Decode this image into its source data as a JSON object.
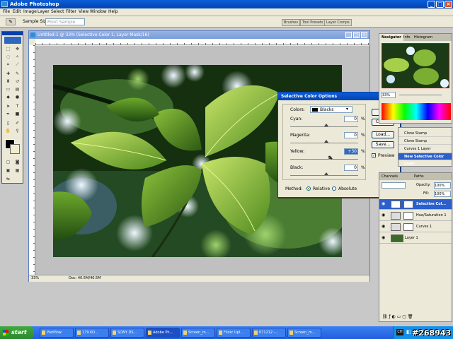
{
  "window": {
    "title": "Adobe Photoshop"
  },
  "menu": [
    "File",
    "Edit",
    "Image",
    "Layer",
    "Select",
    "Filter",
    "View",
    "Window",
    "Help"
  ],
  "options_bar": {
    "sample_size_label": "Sample Size:",
    "sample_size_value": "Point Sample"
  },
  "palette_well": [
    "Brushes",
    "Tool Presets",
    "Layer Comps"
  ],
  "document": {
    "title": "Untitled-1 @ 33% (Selective Color 1, Layer Mask/16)",
    "zoom": "33%",
    "doc_size": "Doc: 40.5M/40.5M"
  },
  "dialog": {
    "title": "Selective Color Options",
    "colors_label": "Colors:",
    "colors_value": "Blacks",
    "fields": [
      {
        "label": "Cyan:",
        "value": "0",
        "pct": "%"
      },
      {
        "label": "Magenta:",
        "value": "0",
        "pct": "%"
      },
      {
        "label": "Yellow:",
        "value": "+30",
        "pct": "%"
      },
      {
        "label": "Black:",
        "value": "0",
        "pct": "%"
      }
    ],
    "method_label": "Method:",
    "method_relative": "Relative",
    "method_absolute": "Absolute",
    "ok": "OK",
    "cancel": "Cancel",
    "load": "Load...",
    "save": "Save...",
    "preview": "Preview"
  },
  "navigator": {
    "tabs": [
      "Navigator",
      "Info",
      "Histogram"
    ]
  },
  "history": {
    "items": [
      "Clone Stamp",
      "Clone Stamp",
      "Curves 1 Layer",
      "New Selective Color Layer"
    ]
  },
  "layers": {
    "tabs": [
      "Channels",
      "Paths"
    ],
    "opacity_label": "Opacity:",
    "opacity_value": "100%",
    "fill_label": "Fill:",
    "fill_value": "100%",
    "items": [
      "Selective Col...",
      "Hue/Saturation 1",
      "Curves 1",
      "Layer 1"
    ]
  },
  "taskbar": {
    "start": "start",
    "tasks": [
      "Pixtiflow",
      "179 KO...",
      "SONY DS...",
      "Adobe Ph...",
      "Screen_m...",
      "Flickr Upl...",
      "071212 -...",
      "Screen_m..."
    ],
    "watermark": "#268943"
  }
}
